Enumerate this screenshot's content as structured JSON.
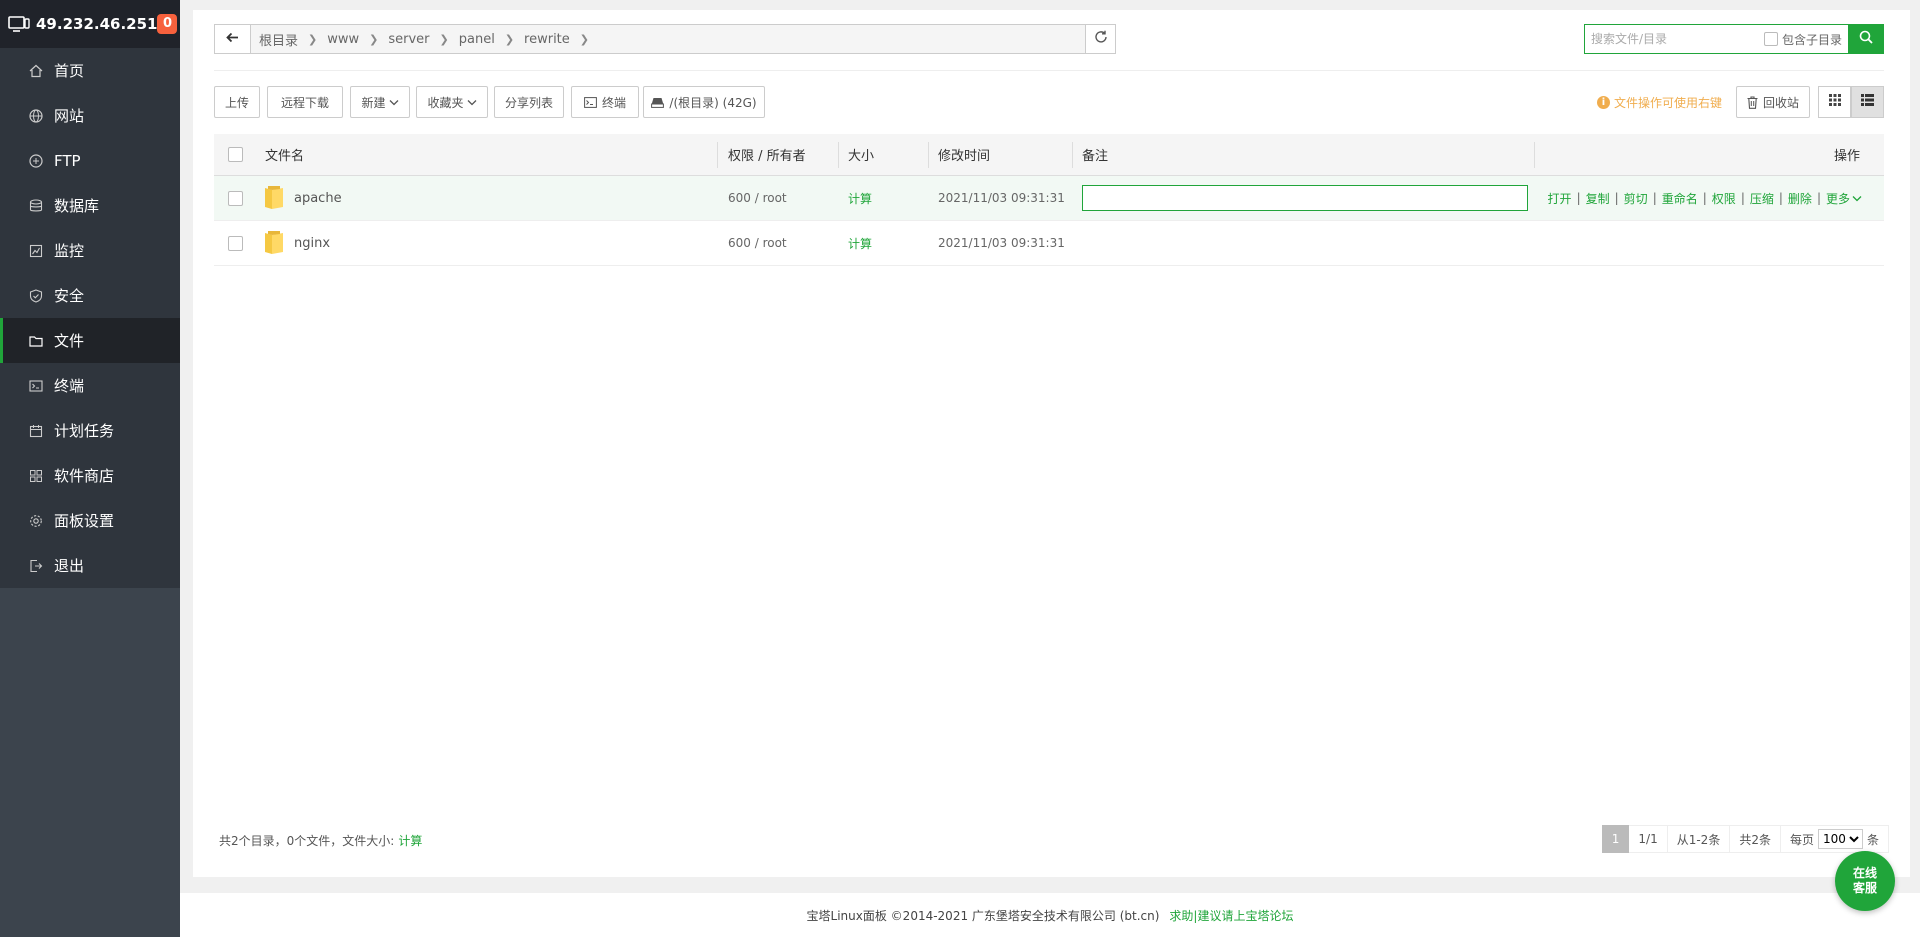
{
  "sidebar": {
    "ip": "49.232.46.251",
    "badge": "0",
    "items": [
      {
        "label": "首页",
        "icon": "home-icon"
      },
      {
        "label": "网站",
        "icon": "globe-icon"
      },
      {
        "label": "FTP",
        "icon": "ftp-icon"
      },
      {
        "label": "数据库",
        "icon": "database-icon"
      },
      {
        "label": "监控",
        "icon": "monitor-icon"
      },
      {
        "label": "安全",
        "icon": "shield-icon"
      },
      {
        "label": "文件",
        "icon": "folder-icon",
        "active": true
      },
      {
        "label": "终端",
        "icon": "terminal-icon"
      },
      {
        "label": "计划任务",
        "icon": "calendar-icon"
      },
      {
        "label": "软件商店",
        "icon": "apps-icon"
      },
      {
        "label": "面板设置",
        "icon": "gear-icon"
      },
      {
        "label": "退出",
        "icon": "logout-icon"
      }
    ]
  },
  "path": {
    "crumbs": [
      "根目录",
      "www",
      "server",
      "panel",
      "rewrite"
    ]
  },
  "search": {
    "placeholder": "搜索文件/目录",
    "include_sub": "包含子目录"
  },
  "toolbar": {
    "upload": "上传",
    "remote_download": "远程下载",
    "new": "新建",
    "favorites": "收藏夹",
    "share_list": "分享列表",
    "terminal": "终端",
    "disk": "/(根目录) (42G)",
    "hint": "文件操作可使用右键",
    "recycle": "回收站"
  },
  "table": {
    "headers": {
      "name": "文件名",
      "perm": "权限 / 所有者",
      "size": "大小",
      "mtime": "修改时间",
      "remark": "备注",
      "ops": "操作"
    },
    "rows": [
      {
        "name": "apache",
        "perm": "600 / root",
        "size": "计算",
        "mtime": "2021/11/03 09:31:31"
      },
      {
        "name": "nginx",
        "perm": "600 / root",
        "size": "计算",
        "mtime": "2021/11/03 09:31:31"
      }
    ],
    "ops": [
      "打开",
      "复制",
      "剪切",
      "重命名",
      "权限",
      "压缩",
      "删除",
      "更多"
    ]
  },
  "summary": {
    "text": "共2个目录，0个文件，文件大小:",
    "calc": "计算"
  },
  "pager": {
    "current": "1",
    "pages": "1/1",
    "range": "从1-2条",
    "total": "共2条",
    "per_page_label": "每页",
    "per_page_value": "100",
    "unit": "条"
  },
  "footer": {
    "copyright": "宝塔Linux面板 ©2014-2021 广东堡塔安全技术有限公司 (bt.cn)",
    "link": "求助|建议请上宝塔论坛"
  },
  "service": {
    "line1": "在线",
    "line2": "客服"
  },
  "colors": {
    "accent": "#20a53a",
    "sidebar": "#3c444d",
    "badge": "#f7613d",
    "hint": "#f0ad4e"
  }
}
